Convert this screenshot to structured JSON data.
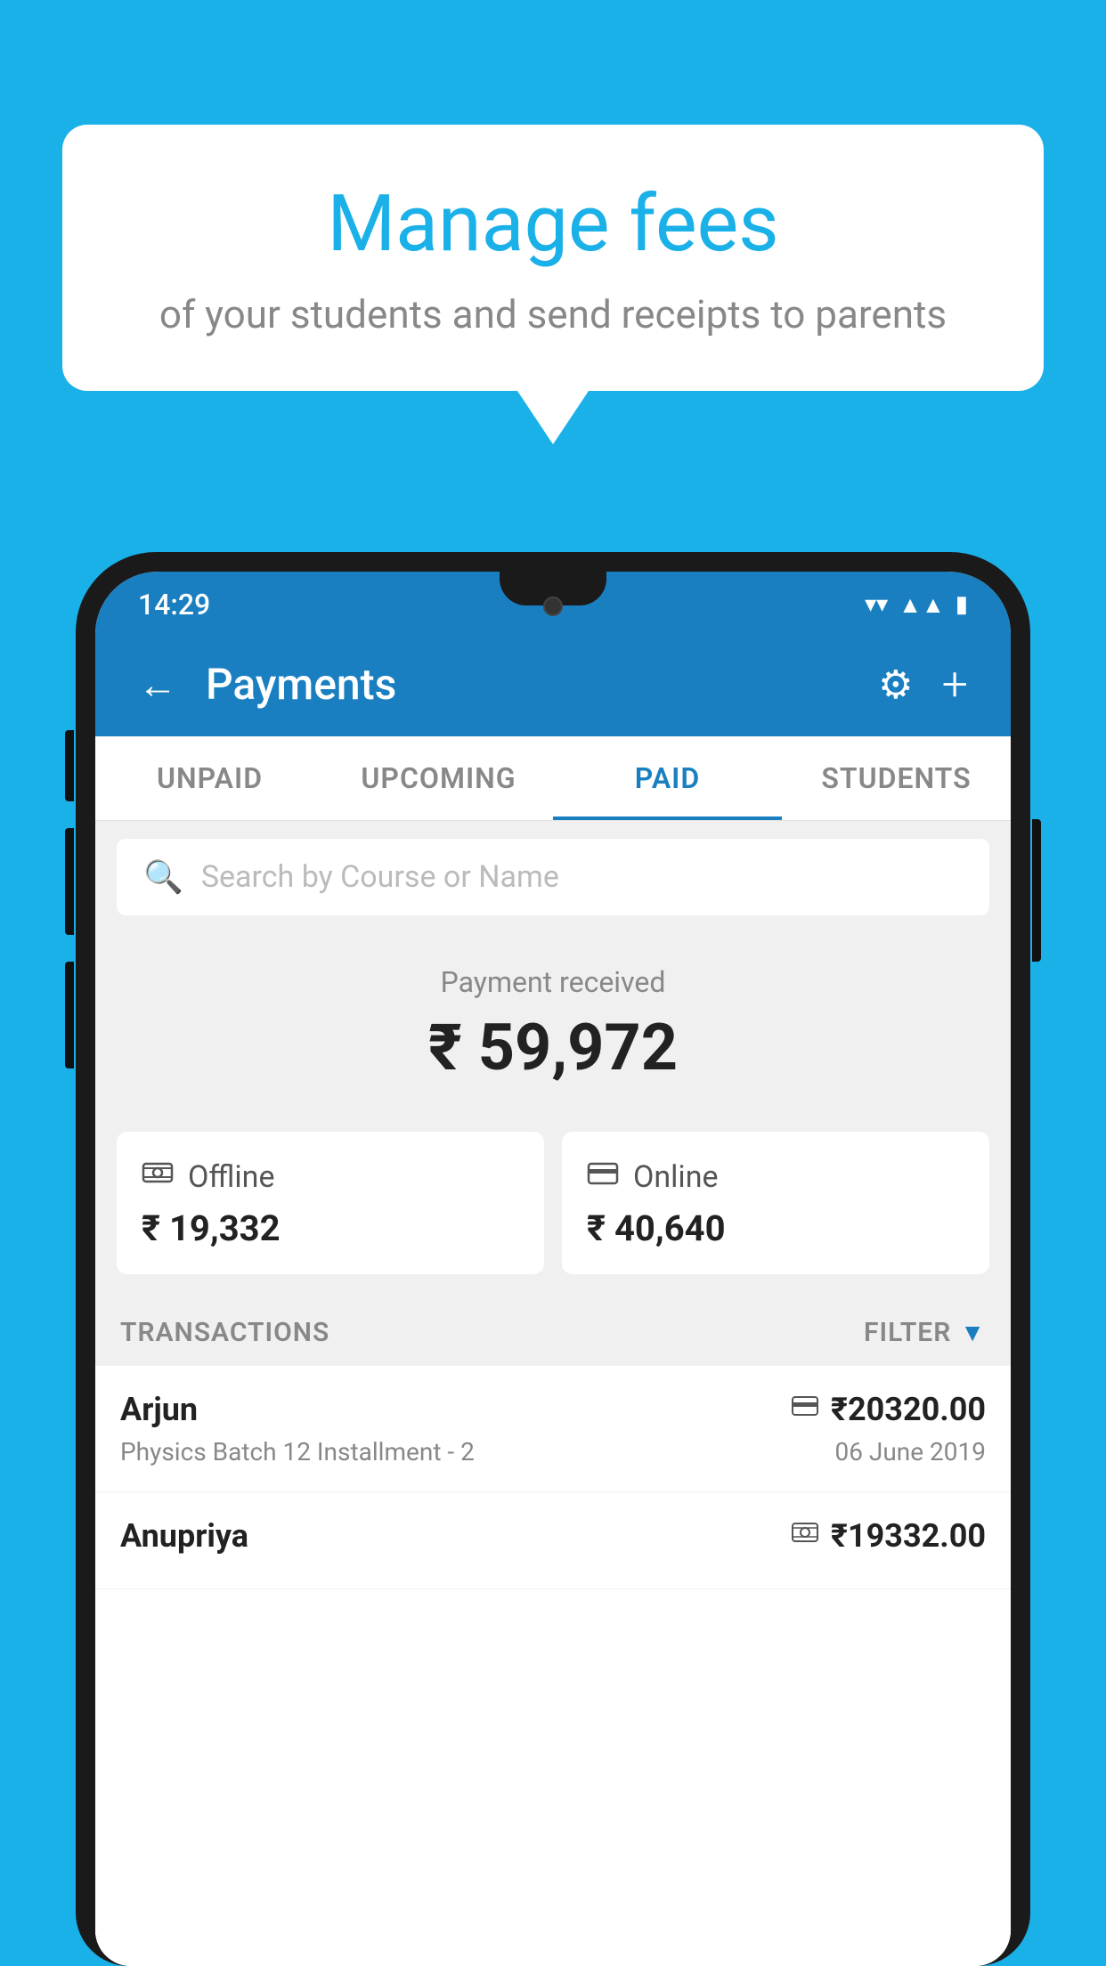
{
  "background_color": "#1ab0e8",
  "hero": {
    "title": "Manage fees",
    "subtitle": "of your students and send receipts to parents"
  },
  "status_bar": {
    "time": "14:29",
    "wifi_icon": "▼",
    "signal_icon": "▲",
    "battery_icon": "▮"
  },
  "header": {
    "title": "Payments",
    "back_label": "←",
    "settings_icon": "⚙",
    "add_icon": "+"
  },
  "tabs": [
    {
      "id": "unpaid",
      "label": "UNPAID",
      "active": false
    },
    {
      "id": "upcoming",
      "label": "UPCOMING",
      "active": false
    },
    {
      "id": "paid",
      "label": "PAID",
      "active": true
    },
    {
      "id": "students",
      "label": "STUDENTS",
      "active": false
    }
  ],
  "search": {
    "placeholder": "Search by Course or Name"
  },
  "payment_received": {
    "label": "Payment received",
    "amount": "₹ 59,972"
  },
  "payment_cards": [
    {
      "type": "Offline",
      "amount": "₹ 19,332",
      "icon": "💳"
    },
    {
      "type": "Online",
      "amount": "₹ 40,640",
      "icon": "💳"
    }
  ],
  "transactions_header": {
    "label": "TRANSACTIONS",
    "filter_label": "FILTER"
  },
  "transactions": [
    {
      "name": "Arjun",
      "course": "Physics Batch 12 Installment - 2",
      "amount": "₹20320.00",
      "date": "06 June 2019",
      "icon_type": "online"
    },
    {
      "name": "Anupriya",
      "course": "",
      "amount": "₹19332.00",
      "date": "",
      "icon_type": "offline"
    }
  ]
}
